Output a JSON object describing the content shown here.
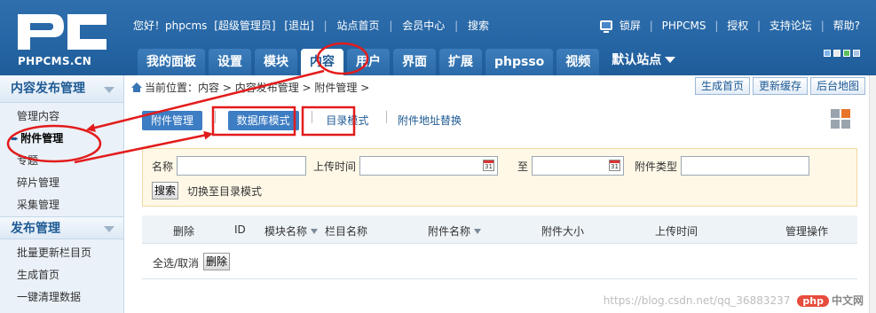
{
  "header": {
    "logo_subtitle": "PHPCMS.CN",
    "greeting": "您好！phpcms",
    "role": "[超级管理员]",
    "logout": "[退出]",
    "site_home": "站点首页",
    "member_center": "会员中心",
    "search": "搜索",
    "lock_screen": "锁屏",
    "phpcms": "PHPCMS",
    "authorize": "授权",
    "support_forum": "支持论坛",
    "help": "帮助?",
    "skin_colors": [
      "#7eb2e8",
      "#e8e8e8",
      "#5fbf5f",
      "#a9c4e4"
    ]
  },
  "nav": {
    "tabs": [
      "我的面板",
      "设置",
      "模块",
      "内容",
      "用户",
      "界面",
      "扩展",
      "phpsso",
      "视频"
    ],
    "active_tab": "内容",
    "default_site": "默认站点"
  },
  "sidebar": {
    "group1_title": "内容发布管理",
    "group1_items": [
      "管理内容",
      "附件管理",
      "专题",
      "碎片管理",
      "采集管理"
    ],
    "active_item": "附件管理",
    "group2_title": "发布管理",
    "group2_items": [
      "批量更新栏目页",
      "生成首页",
      "一键清理数据"
    ]
  },
  "breadcrumb": {
    "prefix": "当前位置：",
    "path": "内容 > 内容发布管理 > 附件管理 >"
  },
  "quick_buttons": [
    "生成首页",
    "更新缓存",
    "后台地图"
  ],
  "mode_tabs": {
    "attachment_manage": "附件管理",
    "database_mode": "数据库模式",
    "directory_mode": "目录模式",
    "url_replace": "附件地址替换"
  },
  "search": {
    "name_label": "名称",
    "name_value": "",
    "upload_time_label": "上传时间",
    "to_label": "至",
    "start_date": "",
    "end_date": "",
    "type_label": "附件类型",
    "type_value": "",
    "search_button": "搜索",
    "switch_text": "切换至目录模式"
  },
  "table": {
    "columns": [
      "删除",
      "ID",
      "模块名称",
      "栏目名称",
      "附件名称",
      "附件大小",
      "上传时间",
      "管理操作"
    ],
    "rows": []
  },
  "footer": {
    "select_all": "全选/取消",
    "delete_button": "删除"
  },
  "watermark": {
    "url": "https://blog.csdn.net/qq_36883237",
    "badge": "php",
    "site": "中文网"
  },
  "colors": {
    "header_blue": "#2565a4",
    "annotation_red": "#e31b1b",
    "tab_blue": "#3d7dc4"
  }
}
